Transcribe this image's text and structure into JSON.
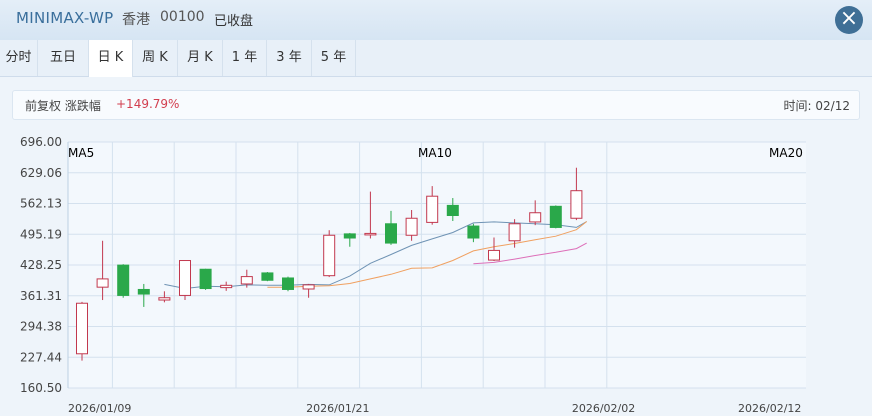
{
  "header": {
    "title": "MINIMAX-WP",
    "market": "香港",
    "code": "00100",
    "status": "已收盘",
    "close_icon": "close-icon",
    "close_glyph": "×"
  },
  "tabs": [
    {
      "label": "分时",
      "active": false
    },
    {
      "label": "五日",
      "active": false
    },
    {
      "label": "日 K",
      "active": true
    },
    {
      "label": "周 K",
      "active": false
    },
    {
      "label": "月 K",
      "active": false
    },
    {
      "label": "1 年",
      "active": false
    },
    {
      "label": "3 年",
      "active": false
    },
    {
      "label": "5 年",
      "active": false
    }
  ],
  "info": {
    "label": "前复权 涨跌幅",
    "change": "+149.79%",
    "time": "时间: 02/12"
  },
  "colors": {
    "up": "#c2384e",
    "down": "#2aa84a",
    "ma5": "#6f93b4",
    "ma10": "#f0a060",
    "ma20": "#dd6fb9",
    "grid": "#d4e1ee",
    "plot_bg": "#f3f8fd"
  },
  "chart_data": {
    "type": "candlestick",
    "ylim": [
      160.5,
      696.0
    ],
    "y_ticks": [
      "696.00",
      "629.06",
      "562.13",
      "495.19",
      "428.25",
      "361.31",
      "294.38",
      "227.44",
      "160.50"
    ],
    "x_ticks": [
      {
        "label": "2026/01/09",
        "index": 0
      },
      {
        "label": "2026/01/21",
        "index": 8
      },
      {
        "label": "2026/02/02",
        "index": 17
      },
      {
        "label": "2026/02/12",
        "index": 25
      }
    ],
    "legend": [
      "MA5",
      "MA10",
      "MA20"
    ],
    "candles": [
      {
        "o": 235,
        "h": 348,
        "l": 220,
        "c": 345
      },
      {
        "o": 380,
        "h": 481,
        "l": 352,
        "c": 398
      },
      {
        "o": 428,
        "h": 430,
        "l": 357,
        "c": 362
      },
      {
        "o": 375,
        "h": 387,
        "l": 337,
        "c": 365
      },
      {
        "o": 352,
        "h": 371,
        "l": 347,
        "c": 357
      },
      {
        "o": 362,
        "h": 438,
        "l": 352,
        "c": 438
      },
      {
        "o": 419,
        "h": 420,
        "l": 374,
        "c": 377
      },
      {
        "o": 379,
        "h": 392,
        "l": 372,
        "c": 384
      },
      {
        "o": 387,
        "h": 418,
        "l": 379,
        "c": 403
      },
      {
        "o": 411,
        "h": 413,
        "l": 393,
        "c": 395
      },
      {
        "o": 400,
        "h": 403,
        "l": 371,
        "c": 375
      },
      {
        "o": 376,
        "h": 387,
        "l": 357,
        "c": 385
      },
      {
        "o": 405,
        "h": 504,
        "l": 402,
        "c": 493
      },
      {
        "o": 496,
        "h": 498,
        "l": 468,
        "c": 487
      },
      {
        "o": 497,
        "h": 588,
        "l": 486,
        "c": 497
      },
      {
        "o": 518,
        "h": 546,
        "l": 472,
        "c": 476
      },
      {
        "o": 493,
        "h": 548,
        "l": 481,
        "c": 530
      },
      {
        "o": 521,
        "h": 600,
        "l": 516,
        "c": 578
      },
      {
        "o": 558,
        "h": 574,
        "l": 524,
        "c": 536
      },
      {
        "o": 513,
        "h": 518,
        "l": 478,
        "c": 487
      },
      {
        "o": 439,
        "h": 488,
        "l": 437,
        "c": 460
      },
      {
        "o": 481,
        "h": 528,
        "l": 466,
        "c": 518
      },
      {
        "o": 522,
        "h": 569,
        "l": 515,
        "c": 542
      },
      {
        "o": 556,
        "h": 558,
        "l": 508,
        "c": 510
      },
      {
        "o": 530,
        "h": 640,
        "l": 526,
        "c": 590
      }
    ],
    "ma5": [
      null,
      null,
      null,
      null,
      386,
      377,
      382,
      381,
      385,
      384,
      384,
      386,
      385,
      404,
      432,
      451,
      471,
      485,
      499,
      520,
      522,
      520,
      518,
      516,
      510,
      523
    ],
    "ma10": [
      null,
      null,
      null,
      null,
      null,
      null,
      null,
      null,
      null,
      380,
      380,
      382,
      383,
      388,
      398,
      408,
      421,
      422,
      438,
      459,
      468,
      475,
      483,
      491,
      505,
      523
    ],
    "ma20": [
      null,
      null,
      null,
      null,
      null,
      null,
      null,
      null,
      null,
      null,
      null,
      null,
      null,
      null,
      null,
      null,
      null,
      null,
      null,
      431,
      434,
      441,
      449,
      456,
      464,
      476
    ]
  }
}
